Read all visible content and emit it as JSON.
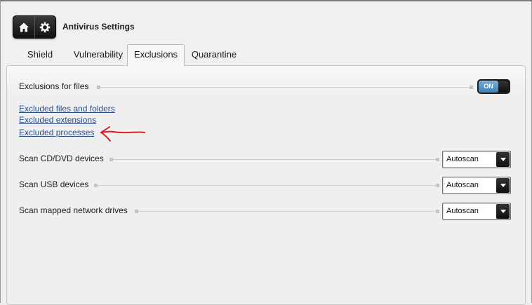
{
  "header": {
    "title": "Antivirus Settings",
    "nav_icons": [
      "home-icon",
      "gear-icon"
    ]
  },
  "tabs": [
    {
      "label": "Shield",
      "active": false
    },
    {
      "label": "Vulnerability",
      "active": false
    },
    {
      "label": "Exclusions",
      "active": true
    },
    {
      "label": "Quarantine",
      "active": false
    }
  ],
  "exclusions": {
    "label": "Exclusions for files",
    "toggle_state": "ON",
    "toggle_color": "#4a8cc0"
  },
  "links": [
    "Excluded files and folders",
    "Excluded extensions",
    "Excluded processes"
  ],
  "scan_rows": [
    {
      "label": "Scan CD/DVD devices",
      "value": "Autoscan"
    },
    {
      "label": "Scan USB devices",
      "value": "Autoscan"
    },
    {
      "label": "Scan mapped network drives",
      "value": "Autoscan"
    }
  ],
  "annotation": {
    "color": "#e02020",
    "points_to": "Excluded processes"
  }
}
